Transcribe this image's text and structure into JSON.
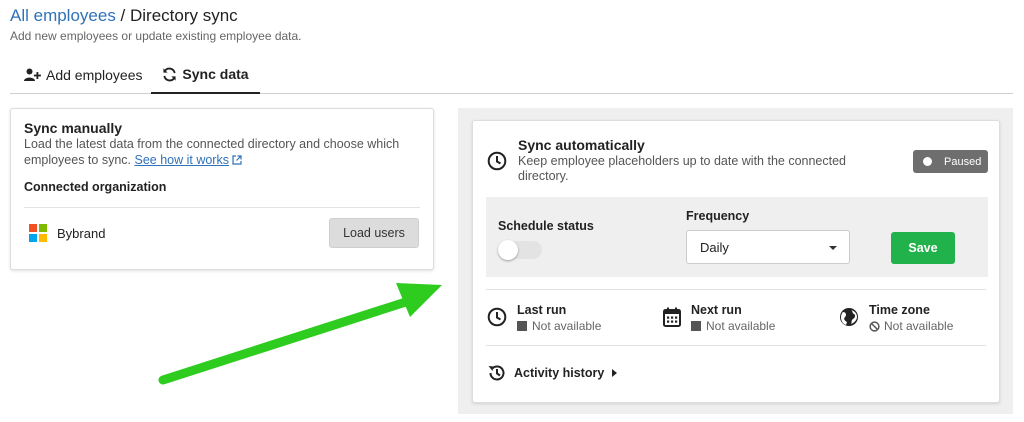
{
  "header": {
    "breadcrumb_link": "All employees",
    "breadcrumb_sep": " / ",
    "title": "Directory sync",
    "subtitle": "Add new employees or update existing employee data."
  },
  "tabs": [
    {
      "label": "Add employees",
      "icon": "user-plus-icon"
    },
    {
      "label": "Sync data",
      "icon": "sync-icon",
      "active": true
    }
  ],
  "manual": {
    "title": "Sync manually",
    "description": "Load the latest data from the connected directory and choose which employees to sync.",
    "link": "See how it works",
    "connected_label": "Connected organization",
    "org_name": "Bybrand",
    "org_icon": "microsoft-logo",
    "load_button": "Load users"
  },
  "auto": {
    "title": "Sync automatically",
    "description": "Keep employee placeholders up to date with the connected directory.",
    "status_badge": "Paused",
    "schedule_label": "Schedule status",
    "schedule_enabled": false,
    "frequency_label": "Frequency",
    "frequency_value": "Daily",
    "save_button": "Save",
    "last_run_label": "Last run",
    "last_run_value": "Not available",
    "next_run_label": "Next run",
    "next_run_value": "Not available",
    "timezone_label": "Time zone",
    "timezone_value": "Not available",
    "history_label": "Activity history"
  },
  "colors": {
    "link": "#2f72b8",
    "save": "#22b24c",
    "badge": "#6e6e6e",
    "annotation_arrow": "#2ecc1f",
    "ms_red": "#f25022",
    "ms_green": "#7fba00",
    "ms_blue": "#00a4ef",
    "ms_yellow": "#ffb900"
  }
}
